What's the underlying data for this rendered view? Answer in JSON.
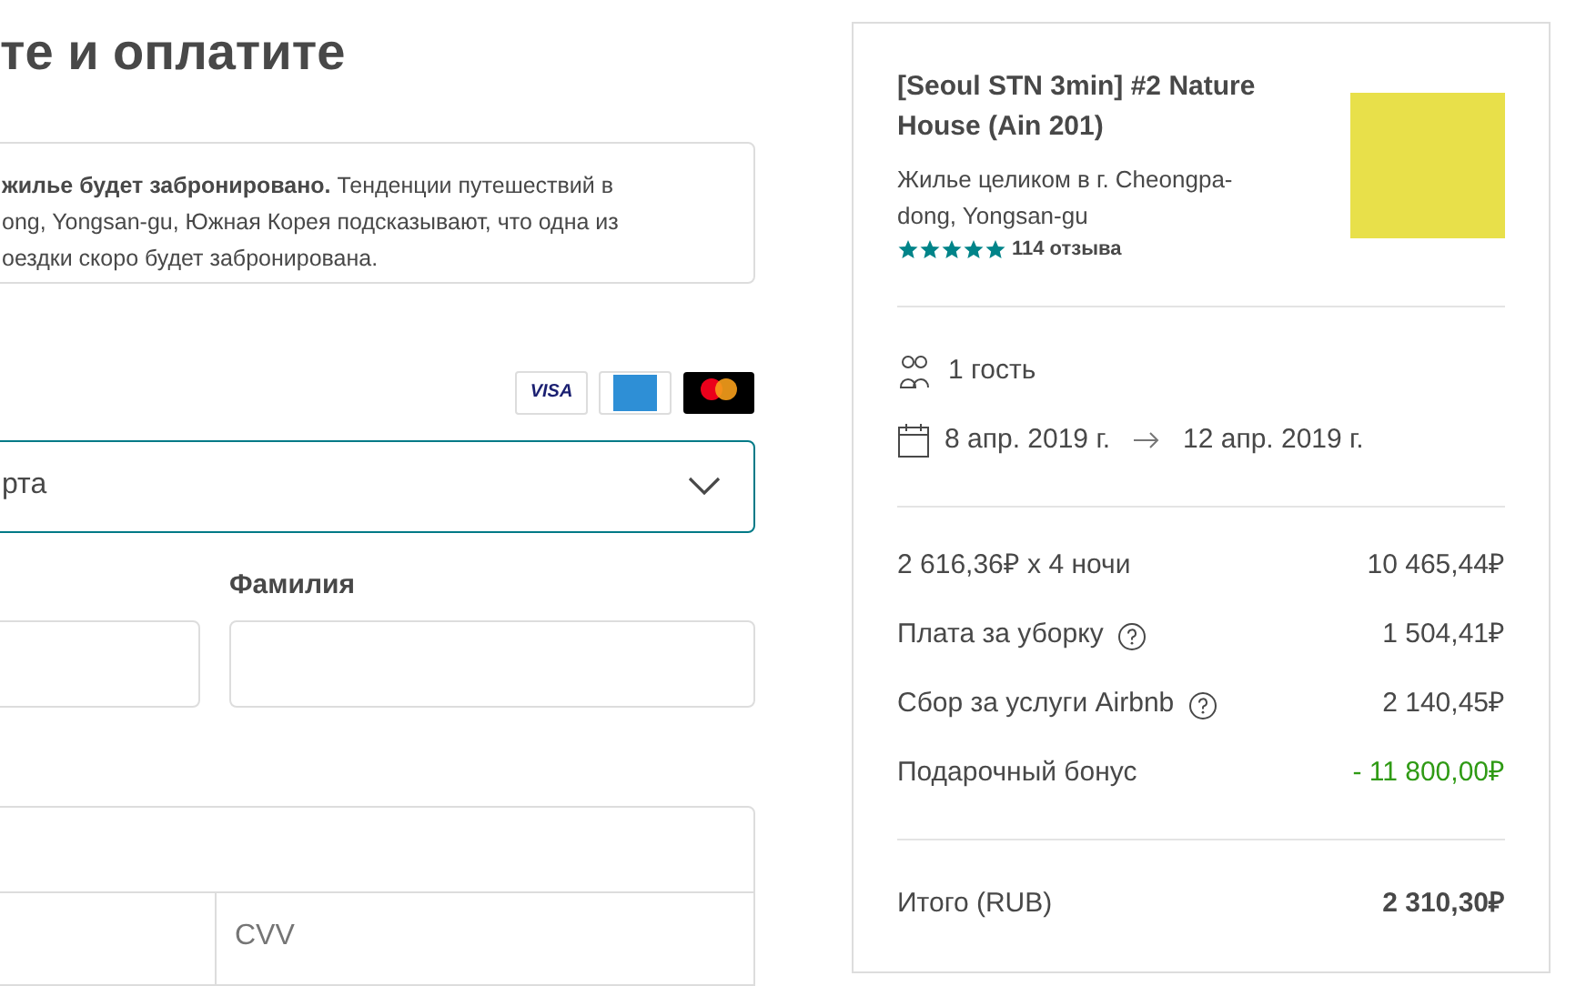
{
  "heading": "те и оплатите",
  "notice": {
    "lines": [
      "**жилье будет забронировано.**  Тенденции путешествий в",
      "ong, Yongsan-gu, Южная Корея подсказывают, что одна из",
      "оездки скоро будет забронирована."
    ]
  },
  "payment": {
    "card_logos": [
      {
        "kind": "visa",
        "text": "VISA"
      },
      {
        "kind": "amex"
      },
      {
        "kind": "mastercard"
      }
    ],
    "method_select": {
      "value": "рта"
    },
    "last_name_label": "Фамилия",
    "cvv_placeholder": "CVV"
  },
  "listing": {
    "title": "[Seoul STN 3min] #2 Nature House (Ain 201)",
    "subtitle": "Жилье целиком в г. Cheongpa-dong, Yongsan-gu",
    "stars": 5,
    "reviews": "114 отзыва"
  },
  "guests": "1 гость",
  "dates": {
    "check_in": "8 апр. 2019 г.",
    "check_out": "12 апр. 2019 г."
  },
  "price_rows": [
    {
      "label": "2 616,36₽ x 4 ночи",
      "amount": "10 465,44₽",
      "help": false,
      "kind": "charge"
    },
    {
      "label": "Плата за уборку",
      "amount": "1 504,41₽",
      "help": true,
      "kind": "charge"
    },
    {
      "label": "Сбор за услуги Airbnb",
      "amount": "2 140,45₽",
      "help": true,
      "kind": "charge"
    },
    {
      "label": "Подарочный бонус",
      "amount": "- 11 800,00₽",
      "help": false,
      "kind": "discount"
    }
  ],
  "total": {
    "label": "Итого (RUB)",
    "amount": "2 310,30₽"
  }
}
